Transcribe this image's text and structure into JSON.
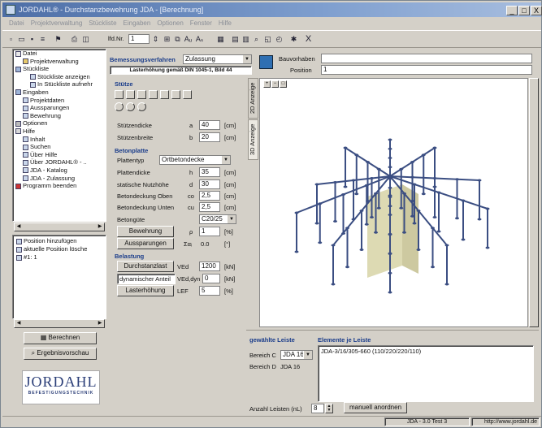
{
  "window": {
    "title": "JORDAHL® - Durchstanzbewehrung JDA - [Berechnung]",
    "controls": {
      "minimize": "_",
      "maximize": "□",
      "close": "X"
    }
  },
  "menu": [
    "Datei",
    "Projektverwaltung",
    "Stückliste",
    "Eingaben",
    "Optionen",
    "Fenster",
    "Hilfe"
  ],
  "toolbar": {
    "pos_label": "lfd.Nr.",
    "pos_value": "1",
    "close_label": "X"
  },
  "tree": {
    "items": [
      {
        "label": "Datei",
        "level": 0,
        "icon": "expand"
      },
      {
        "label": "Projektverwaltung",
        "level": 1,
        "icon": "folder"
      },
      {
        "label": "Stückliste",
        "level": 0,
        "icon": "list"
      },
      {
        "label": "Stückliste anzeigen",
        "level": 2,
        "icon": "doc"
      },
      {
        "label": "In Stückliste aufnehr",
        "level": 2,
        "icon": "doc"
      },
      {
        "label": "Eingaben",
        "level": 0,
        "icon": "list"
      },
      {
        "label": "Projektdaten",
        "level": 1,
        "icon": "doc"
      },
      {
        "label": "Aussparungen",
        "level": 1,
        "icon": "doc"
      },
      {
        "label": "Bewehrung",
        "level": 1,
        "icon": "doc"
      },
      {
        "label": "Optionen",
        "level": 0,
        "icon": "gear"
      },
      {
        "label": "Hilfe",
        "level": 0,
        "icon": "help"
      },
      {
        "label": "Inhalt",
        "level": 1,
        "icon": "doc"
      },
      {
        "label": "Suchen",
        "level": 1,
        "icon": "doc"
      },
      {
        "label": "Über Hilfe",
        "level": 1,
        "icon": "doc"
      },
      {
        "label": "Über JORDAHL® - ..",
        "level": 1,
        "icon": "doc"
      },
      {
        "label": "JDA - Katalog",
        "level": 1,
        "icon": "doc"
      },
      {
        "label": "JDA - Zulassung",
        "level": 1,
        "icon": "doc"
      },
      {
        "label": "Programm beenden",
        "level": 0,
        "icon": "x"
      }
    ]
  },
  "positions": {
    "items": [
      "Position hinzufügen",
      "aktuelle Position lösche",
      "#1: 1"
    ]
  },
  "left_buttons": {
    "calc": "Berechnen",
    "preview": "Ergebnisvorschau"
  },
  "logo": {
    "name": "JORDAHL",
    "tagline": "BEFESTIGUNGSTECHNIK"
  },
  "header": {
    "verfahren_label": "Bemessungsverfahren",
    "verfahren_value": "Zulassung",
    "lasterhoehung_note": "Lasterhöhung gemäß DIN 1045-1, Bild 44",
    "bauvorhaben_label": "Bauvorhaben",
    "bauvorhaben_value": "",
    "position_label": "Position",
    "position_value": "1"
  },
  "stuetze": {
    "title": "Stütze",
    "dicke_label": "Stützendicke",
    "dicke_sym": "a",
    "dicke_val": "40",
    "dicke_unit": "[cm]",
    "breite_label": "Stützenbreite",
    "breite_sym": "b",
    "breite_val": "20",
    "breite_unit": "[cm]"
  },
  "betonplatte": {
    "title": "Betonplatte",
    "typ_label": "Plattentyp",
    "typ_val": "Ortbetondecke",
    "dicke_label": "Plattendicke",
    "dicke_sym": "h",
    "dicke_val": "35",
    "dicke_unit": "[cm]",
    "nutz_label": "statische Nutzhöhe",
    "nutz_sym": "d",
    "nutz_val": "30",
    "nutz_unit": "[cm]",
    "oben_label": "Betondeckung Oben",
    "oben_sym": "co",
    "oben_val": "2,5",
    "oben_unit": "[cm]",
    "unten_label": "Betondeckung Unten",
    "unten_sym": "cu",
    "unten_val": "2,5",
    "unten_unit": "[cm]",
    "guete_label": "Betongüte",
    "guete_val": "C20/25",
    "bew_btn": "Bewehrung",
    "bew_sym": "ρ",
    "bew_val": "1",
    "bew_unit": "[%]",
    "ausp_btn": "Aussparungen",
    "ausp_sym": "Σαᵢ",
    "ausp_val": "0.0",
    "ausp_unit": "[°]"
  },
  "belastung": {
    "title": "Belastung",
    "durch_btn": "Durchstanzlast",
    "durch_sym": "VEd",
    "durch_val": "1200",
    "durch_unit": "[kN]",
    "dyn_label": "dynamischer Anteil",
    "dyn_sym": "VEd,dyn",
    "dyn_val": "0",
    "dyn_unit": "[kN]",
    "last_btn": "Lasterhöhung",
    "last_sym": "LEF",
    "last_val": "5",
    "last_unit": "[%]"
  },
  "view": {
    "tab_2d": "2D Anzeige",
    "tab_3d": "3D Anzeige"
  },
  "bottom": {
    "gew_title": "gewählte Leiste",
    "bereich_c_label": "Bereich C",
    "bereich_c_val": "JDA 16",
    "bereich_d_label": "Bereich D",
    "bereich_d_val": "JDA 16",
    "elemente_title": "Elemente je Leiste",
    "elemente_val": "JDA-3/16/305-660 (110/220/220/110)",
    "anzahl_label": "Anzahl Leisten (nL)",
    "anzahl_val": "8",
    "manuell_btn": "manuell anordnen"
  },
  "status": {
    "version": "JDA - 3.0 Test 3",
    "url": "http://www.jordahl.de"
  },
  "colors": {
    "rebar": "#3b4e82",
    "column": "#d7d3a6",
    "heading": "#1a3c8a"
  }
}
